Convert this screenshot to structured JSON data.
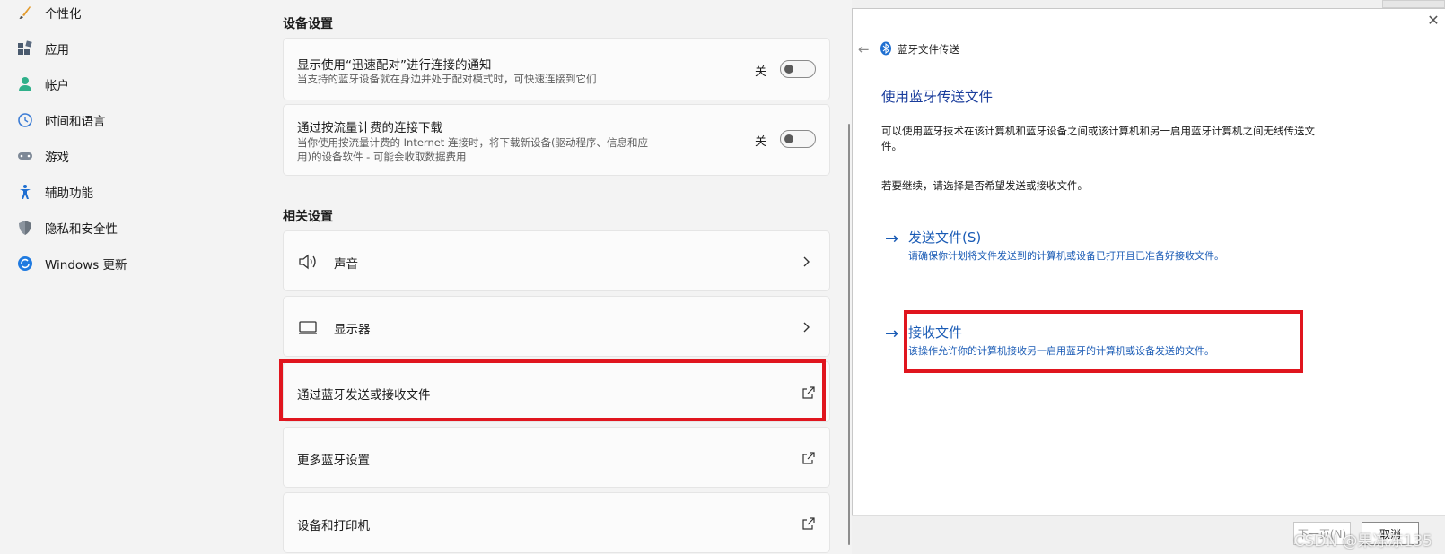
{
  "sidebar": {
    "items": [
      {
        "label": "个性化",
        "icon": "brush-icon"
      },
      {
        "label": "应用",
        "icon": "apps-icon"
      },
      {
        "label": "帐户",
        "icon": "person-icon"
      },
      {
        "label": "时间和语言",
        "icon": "clock-globe-icon"
      },
      {
        "label": "游戏",
        "icon": "gamepad-icon"
      },
      {
        "label": "辅助功能",
        "icon": "accessibility-icon"
      },
      {
        "label": "隐私和安全性",
        "icon": "shield-icon"
      },
      {
        "label": "Windows 更新",
        "icon": "update-icon"
      }
    ]
  },
  "device_settings": {
    "heading": "设备设置",
    "swift_pair": {
      "title": "显示使用“迅速配对”进行连接的通知",
      "desc": "当支持的蓝牙设备就在身边并处于配对模式时，可快速连接到它们",
      "state": "关"
    },
    "metered": {
      "title": "通过按流量计费的连接下载",
      "desc_line1": "当你使用按流量计费的 Internet 连接时，将下载新设备(驱动程序、信息和应",
      "desc_line2": "用)的设备软件 - 可能会收取数据费用",
      "state": "关"
    }
  },
  "related_settings": {
    "heading": "相关设置",
    "sound": "声音",
    "display": "显示器",
    "bluetooth_files": "通过蓝牙发送或接收文件",
    "more_bluetooth": "更多蓝牙设置",
    "devices_printers": "设备和打印机"
  },
  "wizard": {
    "window_title": "蓝牙文件传送",
    "heading": "使用蓝牙传送文件",
    "body_line1": "可以使用蓝牙技术在该计算机和蓝牙设备之间或该计算机和另一启用蓝牙计算机之间无线传送文",
    "body_line2": "件。",
    "prompt": "若要继续，请选择是否希望发送或接收文件。",
    "send": {
      "title": "发送文件(S)",
      "desc": "请确保你计划将文件发送到的计算机或设备已打开且已准备好接收文件。"
    },
    "receive": {
      "title": "接收文件",
      "desc": "该操作允许你的计算机接收另一启用蓝牙的计算机或设备发送的文件。"
    },
    "next_button": "下一页(N)",
    "cancel_button": "取消"
  },
  "watermark": "CSDN @果冻冻135",
  "colors": {
    "highlight": "#e0151e",
    "link_blue": "#1a5bb5",
    "heading_blue": "#1a3d9c"
  }
}
